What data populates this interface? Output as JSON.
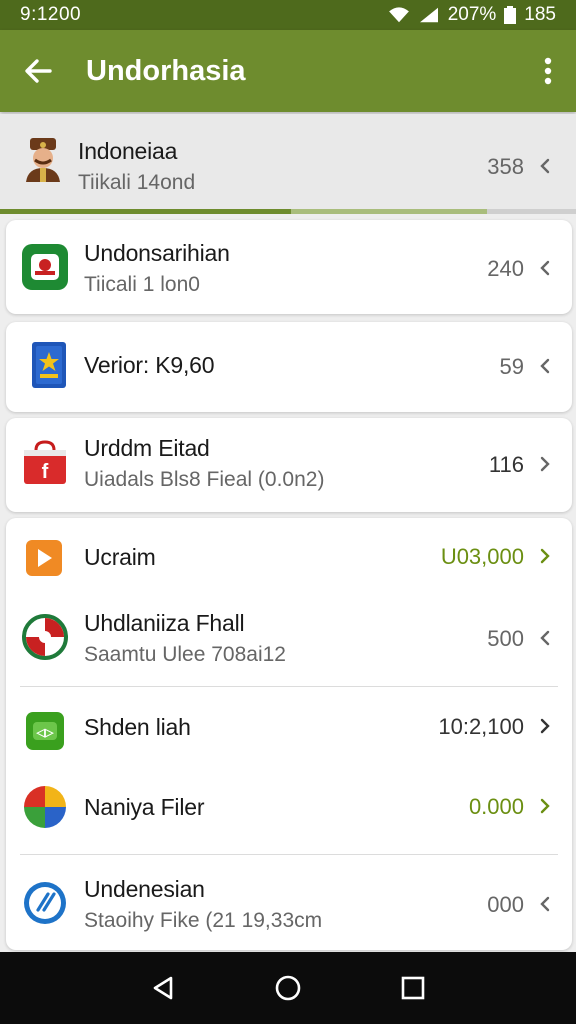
{
  "status_bar": {
    "time": "9:1200",
    "battery": "207%",
    "clock": "185"
  },
  "app_bar": {
    "title": "Undorhasia"
  },
  "rows": [
    {
      "title": "Indoneiaa",
      "subtitle": "Tiikali 14ond",
      "value": "358"
    },
    {
      "title": "Undonsarihian",
      "subtitle": "Tiicali 1 lon0",
      "value": "240"
    },
    {
      "title": "Verior: K9,60",
      "subtitle": "",
      "value": "59"
    },
    {
      "title": "Urddm Eitad",
      "subtitle": "Uiadals Bls8 Fieal (0.0n2)",
      "value": "116"
    },
    {
      "title": "Ucraim",
      "subtitle": "",
      "value": "U03,000"
    },
    {
      "title": "Uhdlaniiza Fhall",
      "subtitle": "Saamtu Ulee 708ai12",
      "value": "500"
    },
    {
      "title": "Shden liah",
      "subtitle": "",
      "value": "10:2,100"
    },
    {
      "title": "Naniya Filer",
      "subtitle": "",
      "value": "0.000"
    },
    {
      "title": "Undenesian",
      "subtitle": "Staoihy Fike (21 19,33cm",
      "value": "000"
    }
  ],
  "progress": {
    "primary": 0.505,
    "secondary": 0.845
  },
  "colors": {
    "accent": "#6e8c2e",
    "status_bar": "#4e6a1c",
    "value_green": "#6b8f12"
  },
  "icons": [
    "back-arrow-icon",
    "overflow-menu-icon",
    "wifi-icon",
    "signal-icon",
    "battery-icon",
    "nav-back-icon",
    "nav-home-icon",
    "nav-recents-icon"
  ]
}
